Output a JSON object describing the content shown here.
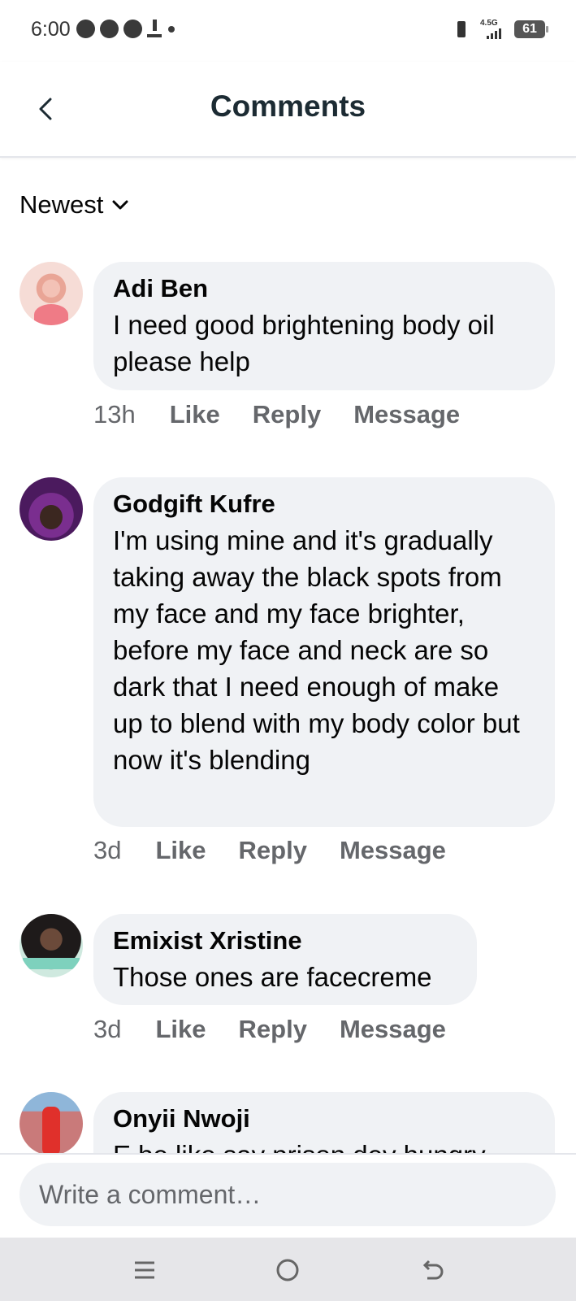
{
  "status_bar": {
    "time": "6:00",
    "network": "4.5G",
    "battery": "61",
    "notification_icons": [
      "facebook-icon",
      "whatsapp-icon",
      "messenger-icon",
      "download-icon",
      "dot-icon"
    ]
  },
  "header": {
    "title": "Comments"
  },
  "sort": {
    "label": "Newest"
  },
  "comments": [
    {
      "author": "Adi Ben",
      "text": "I need good brightening body oil please help",
      "age": "13h",
      "like": "Like",
      "reply": "Reply",
      "message": "Message"
    },
    {
      "author": "Godgift Kufre",
      "text": "I'm using mine and it's gradually taking away the black spots from my face and my face brighter, before my face and neck are so dark that I need enough of make up to blend with my body color but now it's blending",
      "age": "3d",
      "like": "Like",
      "reply": "Reply",
      "message": "Message"
    },
    {
      "author": "Emixist Xristine",
      "text": "Those ones are facecreme",
      "age": "3d",
      "like": "Like",
      "reply": "Reply",
      "message": "Message"
    },
    {
      "author": "Onyii Nwoji",
      "text": "E be like say prison dey hungry"
    }
  ],
  "composer": {
    "placeholder": "Write a comment…"
  },
  "colors": {
    "bubble": "#f0f2f5",
    "secondary_text": "#65676b",
    "title_text": "#1c2b33"
  }
}
